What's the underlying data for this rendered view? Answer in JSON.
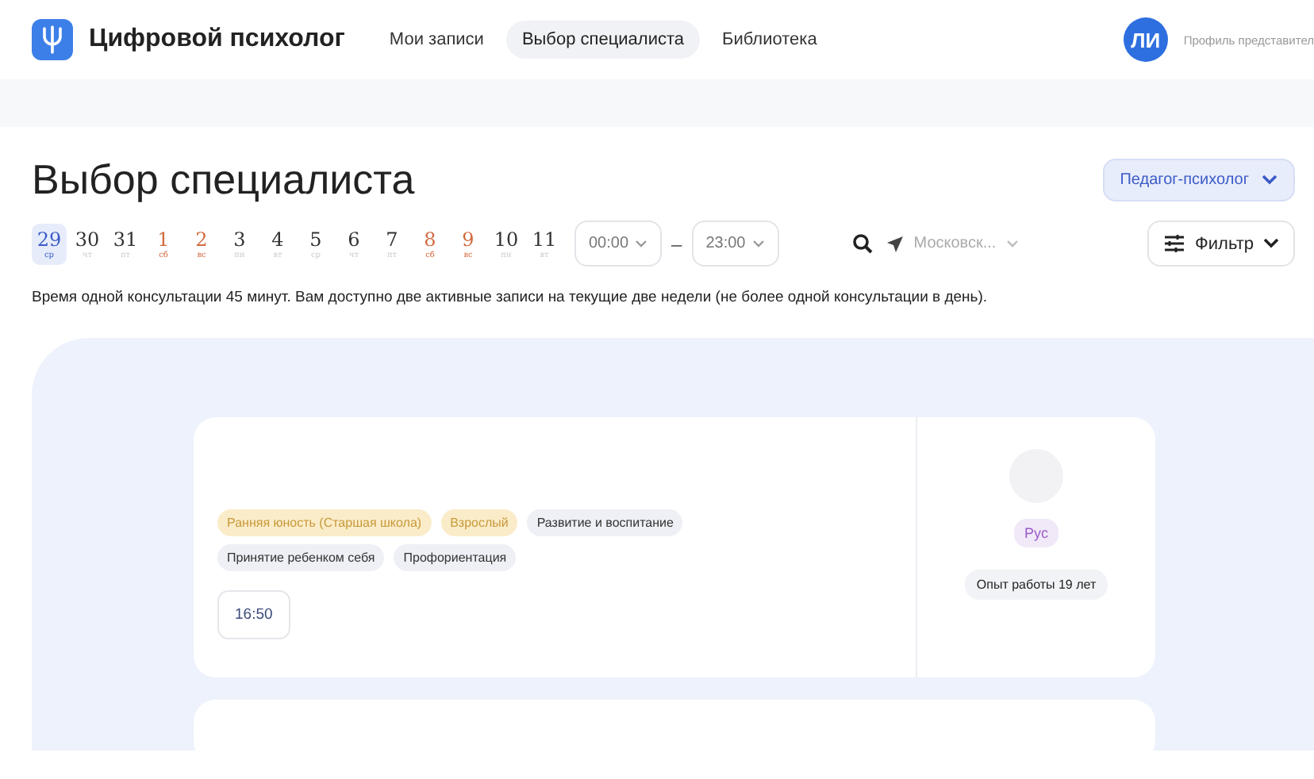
{
  "header": {
    "logo_text": "Цифровой психолог",
    "nav": [
      {
        "label": "Мои записи",
        "selected": false
      },
      {
        "label": "Выбор специалиста",
        "selected": true
      },
      {
        "label": "Библиотека",
        "selected": false
      }
    ],
    "avatar_initials": "ЛИ",
    "profile_label": "Профиль представител"
  },
  "page_title": "Выбор специалиста",
  "specialist_type": "Педагог-психолог",
  "days": [
    {
      "number": "29",
      "weekday": "ср",
      "selected": true,
      "weekend": false
    },
    {
      "number": "30",
      "weekday": "чт",
      "selected": false,
      "weekend": false
    },
    {
      "number": "31",
      "weekday": "пт",
      "selected": false,
      "weekend": false
    },
    {
      "number": "1",
      "weekday": "сб",
      "selected": false,
      "weekend": true
    },
    {
      "number": "2",
      "weekday": "вс",
      "selected": false,
      "weekend": true
    },
    {
      "number": "3",
      "weekday": "пн",
      "selected": false,
      "weekend": false
    },
    {
      "number": "4",
      "weekday": "вт",
      "selected": false,
      "weekend": false
    },
    {
      "number": "5",
      "weekday": "ср",
      "selected": false,
      "weekend": false
    },
    {
      "number": "6",
      "weekday": "чт",
      "selected": false,
      "weekend": false
    },
    {
      "number": "7",
      "weekday": "пт",
      "selected": false,
      "weekend": false
    },
    {
      "number": "8",
      "weekday": "сб",
      "selected": false,
      "weekend": true
    },
    {
      "number": "9",
      "weekday": "вс",
      "selected": false,
      "weekend": true
    },
    {
      "number": "10",
      "weekday": "пн",
      "selected": false,
      "weekend": false
    },
    {
      "number": "11",
      "weekday": "вт",
      "selected": false,
      "weekend": false
    }
  ],
  "time_from": "00:00",
  "time_separator": "–",
  "time_to": "23:00",
  "location": "Московск...",
  "filter_label": "Фильтр",
  "info_text": "Время одной консультации 45 минут. Вам доступно две активные записи на текущие две недели (не более одной консультации в день).",
  "cards": [
    {
      "tags": [
        {
          "label": "Ранняя юность (Старшая школа)",
          "kind": "age"
        },
        {
          "label": "Взрослый",
          "kind": "age"
        },
        {
          "label": "Развитие и воспитание",
          "kind": "topic"
        },
        {
          "label": "Принятие ребенком себя",
          "kind": "topic"
        },
        {
          "label": "Профориентация",
          "kind": "topic"
        }
      ],
      "slots": [
        "16:50"
      ],
      "language": "Рус",
      "experience": "Опыт работы 19 лет"
    }
  ]
}
